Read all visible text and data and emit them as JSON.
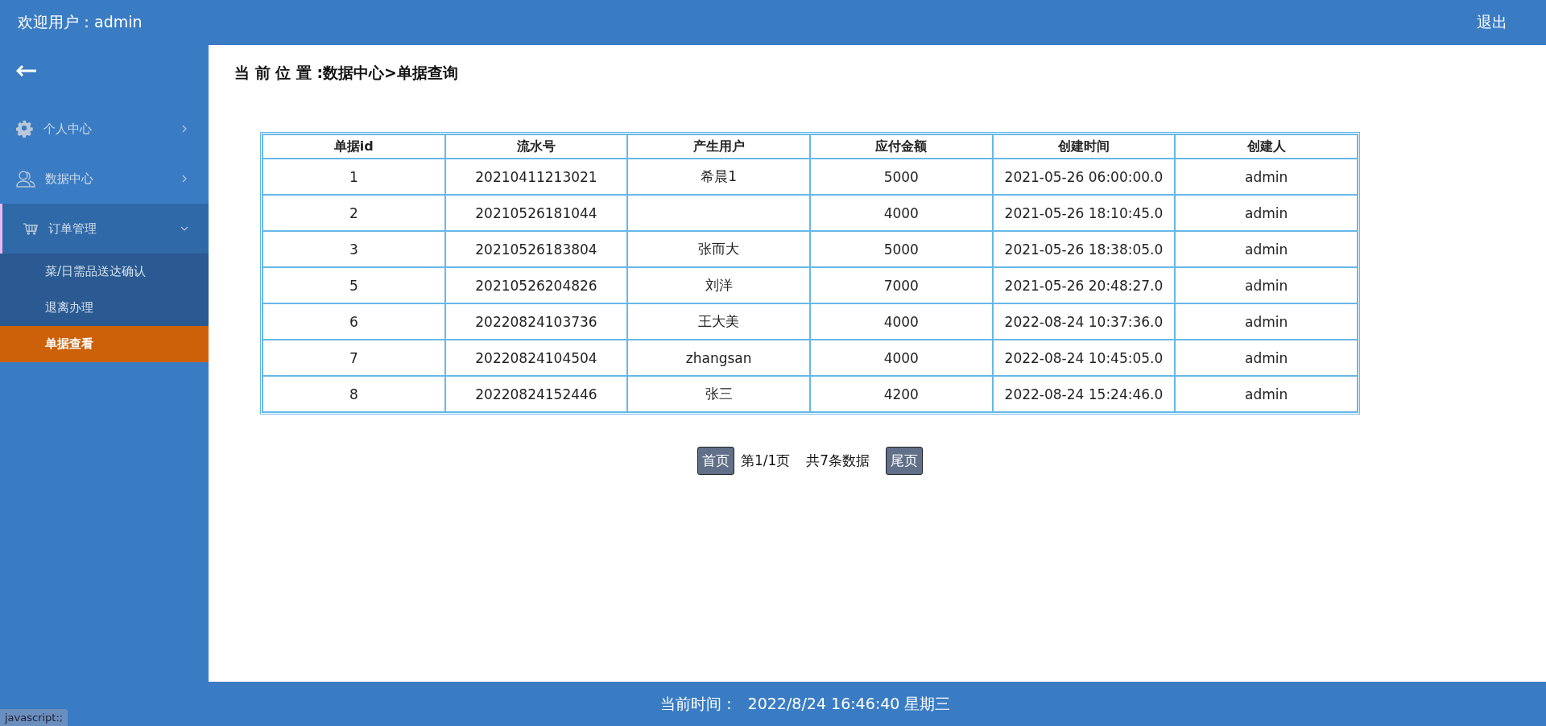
{
  "header": {
    "welcome": "欢迎用户：admin",
    "logout": "退出"
  },
  "sidebar": {
    "items": [
      {
        "label": "个人中心",
        "kind": "gear",
        "expanded": false
      },
      {
        "label": "数据中心",
        "kind": "users",
        "expanded": false
      },
      {
        "label": "订单管理",
        "kind": "cart",
        "expanded": true,
        "children": [
          {
            "label": "菜/日需品送达确认",
            "selected": false
          },
          {
            "label": "退离办理",
            "selected": false
          },
          {
            "label": "单据查看",
            "selected": true
          }
        ]
      }
    ]
  },
  "breadcrumb": "当 前 位 置 :数据中心>单据查询",
  "table": {
    "columns": [
      "单据id",
      "流水号",
      "产生用户",
      "应付金额",
      "创建时间",
      "创建人"
    ],
    "rows": [
      [
        "1",
        "20210411213021",
        "希晨1",
        "5000",
        "2021-05-26 06:00:00.0",
        "admin"
      ],
      [
        "2",
        "20210526181044",
        "",
        "4000",
        "2021-05-26 18:10:45.0",
        "admin"
      ],
      [
        "3",
        "20210526183804",
        "张而大",
        "5000",
        "2021-05-26 18:38:05.0",
        "admin"
      ],
      [
        "5",
        "20210526204826",
        "刘洋",
        "7000",
        "2021-05-26 20:48:27.0",
        "admin"
      ],
      [
        "6",
        "20220824103736",
        "王大美",
        "4000",
        "2022-08-24 10:37:36.0",
        "admin"
      ],
      [
        "7",
        "20220824104504",
        "zhangsan",
        "4000",
        "2022-08-24 10:45:05.0",
        "admin"
      ],
      [
        "8",
        "20220824152446",
        "张三",
        "4200",
        "2022-08-24 15:24:46.0",
        "admin"
      ]
    ]
  },
  "pagination": {
    "first": "首页",
    "page": "第1/1页",
    "total": "共7条数据",
    "last": "尾页"
  },
  "footer": {
    "label": "当前时间：",
    "time": "2022/8/24 16:46:40 星期三"
  },
  "status_bar": "javascript:;"
}
